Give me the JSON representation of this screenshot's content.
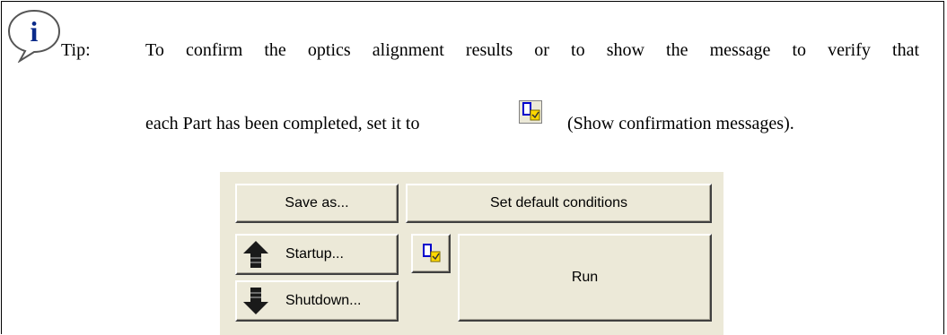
{
  "tip": {
    "label": "Tip:",
    "line1": "To confirm the optics alignment results or to show the message to verify that",
    "line2_before": "each Part has been completed, set it to",
    "line2_after": "(Show confirmation messages)."
  },
  "panel": {
    "save_as": "Save as...",
    "set_default": "Set default conditions",
    "startup": "Startup...",
    "shutdown": "Shutdown...",
    "run": "Run"
  },
  "icons": {
    "tip": "info-speech-bubble-icon",
    "confirm": "show-confirmation-messages-icon",
    "startup": "arrow-up-icon",
    "shutdown": "arrow-down-icon"
  },
  "colors": {
    "panel_bg": "#ece9d8",
    "icon_blue": "#0000cc",
    "icon_yellow": "#ffd800"
  }
}
